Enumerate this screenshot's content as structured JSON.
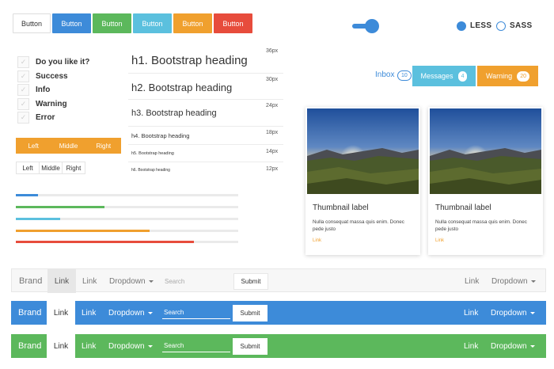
{
  "buttons": [
    {
      "label": "Button",
      "variant": "default",
      "color": "#ffffff"
    },
    {
      "label": "Button",
      "variant": "primary",
      "color": "#3d8bd9"
    },
    {
      "label": "Button",
      "variant": "success",
      "color": "#5cb85c"
    },
    {
      "label": "Button",
      "variant": "info",
      "color": "#5bc0de"
    },
    {
      "label": "Button",
      "variant": "warning",
      "color": "#f0a02e"
    },
    {
      "label": "Button",
      "variant": "danger",
      "color": "#e74c3c"
    }
  ],
  "toggle": {
    "on": true
  },
  "radios": [
    {
      "label": "LESS",
      "checked": true
    },
    {
      "label": "SASS",
      "checked": false
    }
  ],
  "checkboxes": [
    "Do you like it?",
    "Success",
    "Info",
    "Warning",
    "Error"
  ],
  "button_group_orange": [
    "Left",
    "Middle",
    "Right"
  ],
  "button_group_white": [
    "Left",
    "Middle",
    "Right"
  ],
  "progress": [
    {
      "value": 10,
      "color": "#3d8bd9"
    },
    {
      "value": 40,
      "color": "#5cb85c"
    },
    {
      "value": 20,
      "color": "#5bc0de"
    },
    {
      "value": 60,
      "color": "#f0a02e"
    },
    {
      "value": 80,
      "color": "#e74c3c"
    }
  ],
  "headings": [
    {
      "text": "h1. Bootstrap heading",
      "size": "36px"
    },
    {
      "text": "h2. Bootstrap heading",
      "size": "30px"
    },
    {
      "text": "h3. Bootstrap heading",
      "size": "24px"
    },
    {
      "text": "h4. Bootstrap heading",
      "size": "18px"
    },
    {
      "text": "h5. Bootstrap heading",
      "size": "14px"
    },
    {
      "text": "h6. Bootstrap heading",
      "size": "12px"
    }
  ],
  "tabs": {
    "inbox": {
      "label": "Inbox",
      "badge": "10"
    },
    "messages": {
      "label": "Messages",
      "badge": "4",
      "color": "#5bc0de"
    },
    "warning": {
      "label": "Warning",
      "badge": "20",
      "color": "#f0a02e"
    }
  },
  "thumbnails": [
    {
      "title": "Thumbnail label",
      "text": "Nulla consequat massa quis enim. Donec pede justo",
      "link": "Link"
    },
    {
      "title": "Thumbnail label",
      "text": "Nulla consequat massa quis enim. Donec pede justo",
      "link": "Link"
    }
  ],
  "navbars": [
    {
      "variant": "default",
      "bg": "#f7f7f7",
      "brand": "Brand",
      "link_active": "Link",
      "link": "Link",
      "dropdown": "Dropdown",
      "search_placeholder": "Search",
      "submit": "Submit",
      "right_link": "Link",
      "right_dropdown": "Dropdown"
    },
    {
      "variant": "primary",
      "bg": "#3d8bd9",
      "brand": "Brand",
      "link_active": "Link",
      "link": "Link",
      "dropdown": "Dropdown",
      "search_placeholder": "Search",
      "submit": "Submit",
      "right_link": "Link",
      "right_dropdown": "Dropdown"
    },
    {
      "variant": "success",
      "bg": "#5cb85c",
      "brand": "Brand",
      "link_active": "Link",
      "link": "Link",
      "dropdown": "Dropdown",
      "search_placeholder": "Search",
      "submit": "Submit",
      "right_link": "Link",
      "right_dropdown": "Dropdown"
    }
  ]
}
